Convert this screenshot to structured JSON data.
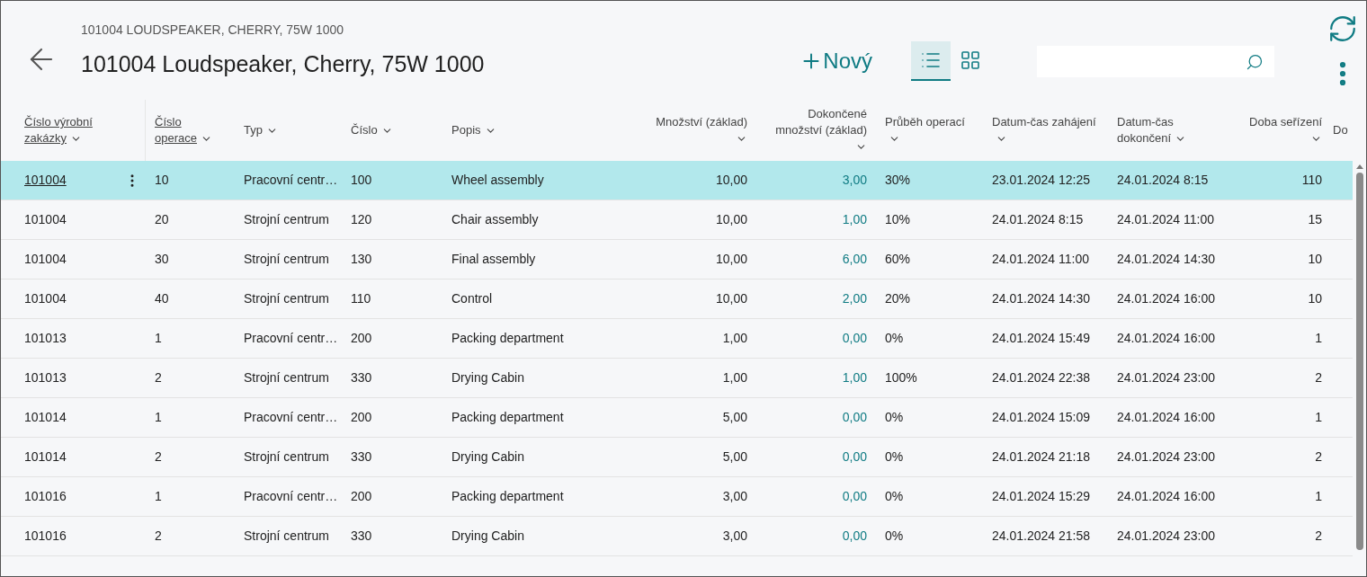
{
  "header": {
    "caption": "101004 LOUDSPEAKER, CHERRY, 75W 1000",
    "title": "101004 Loudspeaker, Cherry, 75W 1000"
  },
  "actions": {
    "new_label": "Nový",
    "views": [
      {
        "kind": "list",
        "selected": true
      },
      {
        "kind": "tiles",
        "selected": false
      }
    ]
  },
  "table": {
    "columns": [
      {
        "label": "Číslo výrobní zakázky",
        "sortable": true,
        "kind": "text"
      },
      {
        "label": "Číslo operace",
        "sortable": true,
        "kind": "text"
      },
      {
        "label": "Typ",
        "sortable": false,
        "kind": "text"
      },
      {
        "label": "Číslo",
        "sortable": false,
        "kind": "text"
      },
      {
        "label": "Popis",
        "sortable": false,
        "kind": "text"
      },
      {
        "label": "Množství (základ)",
        "sortable": false,
        "kind": "number"
      },
      {
        "label": "Dokončené množství (základ)",
        "sortable": false,
        "kind": "drilldown"
      },
      {
        "label": "Průběh operací",
        "sortable": false,
        "kind": "text"
      },
      {
        "label": "Datum-čas zahájení",
        "sortable": false,
        "kind": "text"
      },
      {
        "label": "Datum-čas dokončení",
        "sortable": false,
        "kind": "text"
      },
      {
        "label": "Doba seřízení",
        "sortable": false,
        "kind": "number"
      },
      {
        "label": "Do",
        "sortable": false,
        "kind": "text"
      }
    ],
    "rows": [
      {
        "selected": true,
        "cells": [
          "101004",
          "10",
          "Pracovní centr…",
          "100",
          "Wheel assembly",
          "10,00",
          "3,00",
          "30%",
          "23.01.2024 12:25",
          "24.01.2024 8:15",
          "110"
        ]
      },
      {
        "selected": false,
        "cells": [
          "101004",
          "20",
          "Strojní centrum",
          "120",
          "Chair assembly",
          "10,00",
          "1,00",
          "10%",
          "24.01.2024 8:15",
          "24.01.2024 11:00",
          "15"
        ]
      },
      {
        "selected": false,
        "cells": [
          "101004",
          "30",
          "Strojní centrum",
          "130",
          "Final assembly",
          "10,00",
          "6,00",
          "60%",
          "24.01.2024 11:00",
          "24.01.2024 14:30",
          "10"
        ]
      },
      {
        "selected": false,
        "cells": [
          "101004",
          "40",
          "Strojní centrum",
          "110",
          "Control",
          "10,00",
          "2,00",
          "20%",
          "24.01.2024 14:30",
          "24.01.2024 16:00",
          "10"
        ]
      },
      {
        "selected": false,
        "cells": [
          "101013",
          "1",
          "Pracovní centr…",
          "200",
          "Packing department",
          "1,00",
          "0,00",
          "0%",
          "24.01.2024 15:49",
          "24.01.2024 16:00",
          "1"
        ]
      },
      {
        "selected": false,
        "cells": [
          "101013",
          "2",
          "Strojní centrum",
          "330",
          "Drying Cabin",
          "1,00",
          "1,00",
          "100%",
          "24.01.2024 22:38",
          "24.01.2024 23:00",
          "2"
        ]
      },
      {
        "selected": false,
        "cells": [
          "101014",
          "1",
          "Pracovní centr…",
          "200",
          "Packing department",
          "5,00",
          "0,00",
          "0%",
          "24.01.2024 15:09",
          "24.01.2024 16:00",
          "1"
        ]
      },
      {
        "selected": false,
        "cells": [
          "101014",
          "2",
          "Strojní centrum",
          "330",
          "Drying Cabin",
          "5,00",
          "0,00",
          "0%",
          "24.01.2024 21:18",
          "24.01.2024 23:00",
          "2"
        ]
      },
      {
        "selected": false,
        "cells": [
          "101016",
          "1",
          "Pracovní centr…",
          "200",
          "Packing department",
          "3,00",
          "0,00",
          "0%",
          "24.01.2024 15:29",
          "24.01.2024 16:00",
          "1"
        ]
      },
      {
        "selected": false,
        "cells": [
          "101016",
          "2",
          "Strojní centrum",
          "330",
          "Drying Cabin",
          "3,00",
          "0,00",
          "0%",
          "24.01.2024 21:58",
          "24.01.2024 23:00",
          "2"
        ]
      }
    ]
  }
}
